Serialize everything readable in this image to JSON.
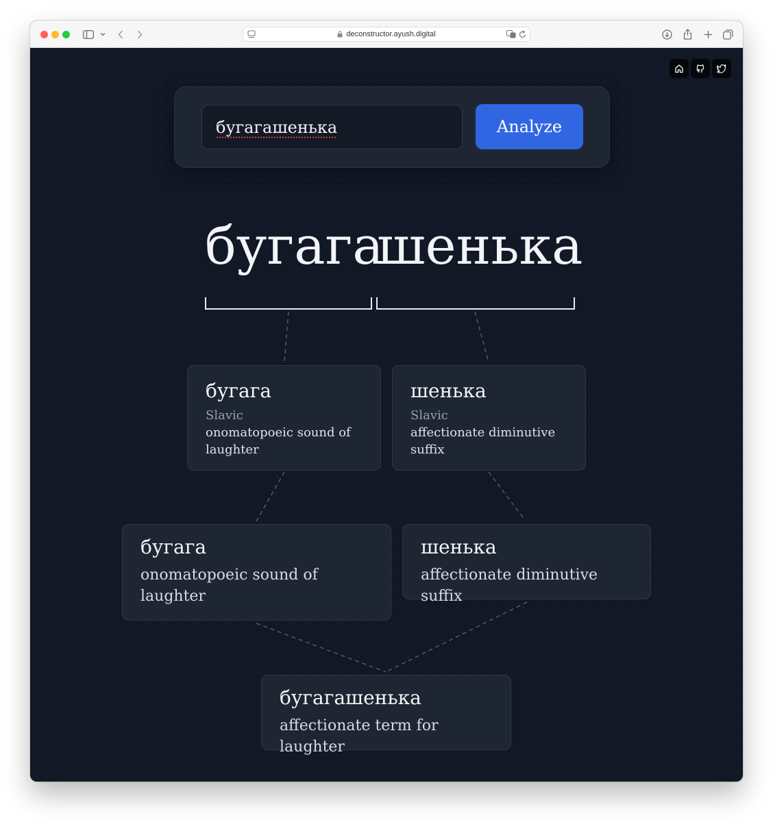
{
  "browser": {
    "url": "deconstructor.ayush.digital"
  },
  "social_links": [
    {
      "icon": "home-icon"
    },
    {
      "icon": "github-icon"
    },
    {
      "icon": "twitter-icon"
    }
  ],
  "search": {
    "value": "бугагашенька",
    "button_label": "Analyze"
  },
  "word": {
    "parts": [
      "бугага",
      "шенька"
    ]
  },
  "parts_level": [
    {
      "text": "бугага",
      "origin": "Slavic",
      "meaning": "onomatopoeic sound of laughter"
    },
    {
      "text": "шенька",
      "origin": "Slavic",
      "meaning": "affectionate diminutive suffix"
    }
  ],
  "combinations_level": [
    {
      "text": "бугага",
      "meaning": "onomatopoeic sound of laughter"
    },
    {
      "text": "шенька",
      "meaning": "affectionate diminutive suffix"
    }
  ],
  "final": {
    "text": "бугагашенька",
    "meaning": "affectionate term for laughter"
  },
  "colors": {
    "background": "#121826",
    "card": "#1f2633",
    "accent": "#3166e3",
    "connector": "#5b6474"
  }
}
